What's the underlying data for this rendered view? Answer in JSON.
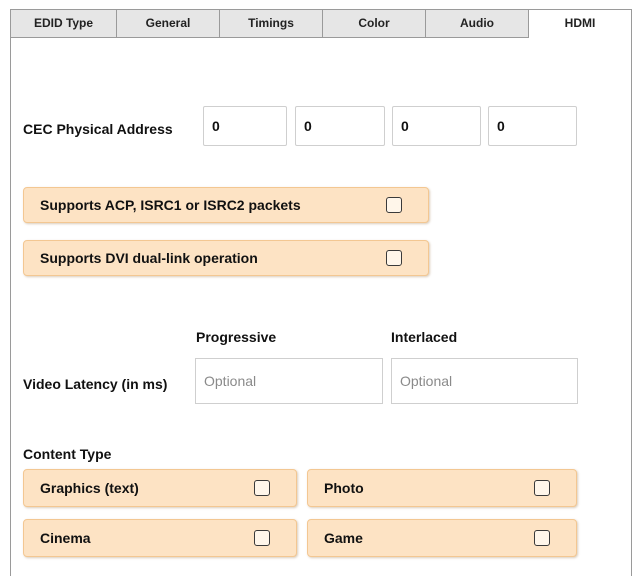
{
  "tabs": [
    {
      "label": "EDID Type",
      "active": false
    },
    {
      "label": "General",
      "active": false
    },
    {
      "label": "Timings",
      "active": false
    },
    {
      "label": "Color",
      "active": false
    },
    {
      "label": "Audio",
      "active": false
    },
    {
      "label": "HDMI",
      "active": true
    }
  ],
  "cec": {
    "label": "CEC Physical Address",
    "fields": [
      "0",
      "0",
      "0",
      "0"
    ]
  },
  "options": [
    {
      "label": "Supports ACP, ISRC1 or ISRC2 packets",
      "checked": false
    },
    {
      "label": "Supports DVI dual-link operation",
      "checked": false
    }
  ],
  "latency": {
    "progressive_label": "Progressive",
    "interlaced_label": "Interlaced",
    "row_label": "Video Latency (in ms)",
    "progressive_placeholder": "Optional",
    "interlaced_placeholder": "Optional"
  },
  "content_type": {
    "heading": "Content Type",
    "items": [
      {
        "label": "Graphics (text)",
        "checked": false
      },
      {
        "label": "Photo",
        "checked": false
      },
      {
        "label": "Cinema",
        "checked": false
      },
      {
        "label": "Game",
        "checked": false
      }
    ]
  },
  "colors": {
    "pill_fill": "#fde3c4",
    "pill_border": "#f3c792",
    "tab_inactive": "#e6e6e6"
  }
}
